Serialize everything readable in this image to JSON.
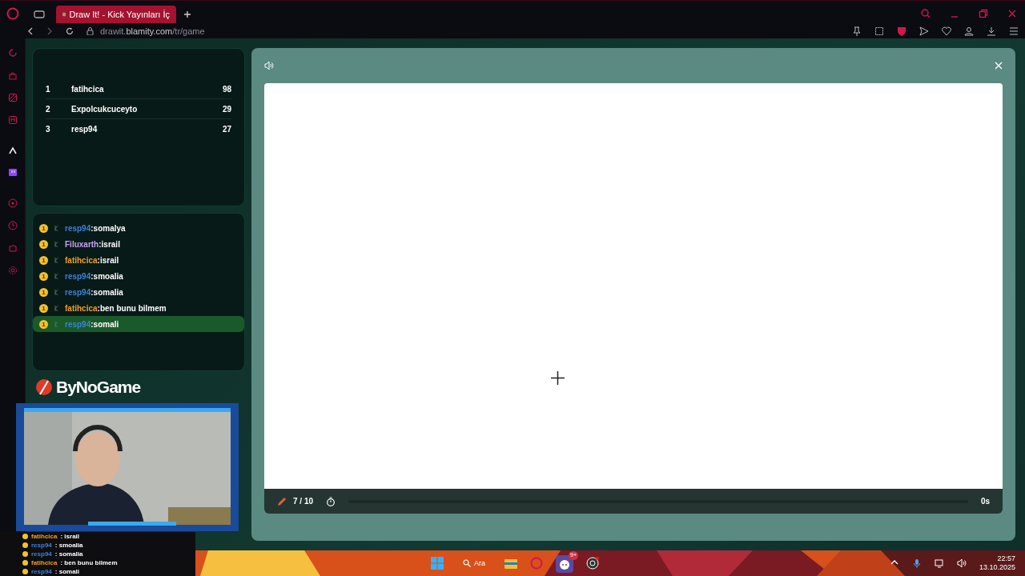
{
  "browser": {
    "tab_title": "Draw It! - Kick Yayınları İç",
    "url_host": "drawit.blamity.com",
    "url_path": "/tr/game"
  },
  "leaderboard": [
    {
      "rank": "1",
      "name": "fatihcica",
      "score": "98"
    },
    {
      "rank": "2",
      "name": "Expolcukcuceyto",
      "score": "29"
    },
    {
      "rank": "3",
      "name": "resp94",
      "score": "27"
    }
  ],
  "chat": [
    {
      "badge": "1",
      "user": "resp94",
      "color": "#3b82d6",
      "text": ":somalya",
      "selected": false
    },
    {
      "badge": "1",
      "user": "Filuxarth",
      "color": "#c9a0f0",
      "text": ":israil",
      "selected": false
    },
    {
      "badge": "1",
      "user": "fatihcica",
      "color": "#f0a020",
      "text": ":israil",
      "selected": false
    },
    {
      "badge": "1",
      "user": "resp94",
      "color": "#3b82d6",
      "text": ":smoalia",
      "selected": false
    },
    {
      "badge": "1",
      "user": "resp94",
      "color": "#3b82d6",
      "text": ":somalia",
      "selected": false
    },
    {
      "badge": "1",
      "user": "fatihcica",
      "color": "#f0a020",
      "text": ":ben bunu bilmem",
      "selected": false
    },
    {
      "badge": "1",
      "user": "resp94",
      "color": "#3b82d6",
      "text": ":somali",
      "selected": true
    }
  ],
  "sponsor": "ByNoGame",
  "stream_overlay_chat": [
    {
      "user": "fatihcica",
      "color": "#f0a020",
      "text": ": israil"
    },
    {
      "user": "resp94",
      "color": "#3b82d6",
      "text": ": smoalia"
    },
    {
      "user": "resp94",
      "color": "#3b82d6",
      "text": ": somalia"
    },
    {
      "user": "fatihcica",
      "color": "#f0a020",
      "text": ": ben bunu bilmem"
    },
    {
      "user": "resp94",
      "color": "#3b82d6",
      "text": ": somali"
    }
  ],
  "game": {
    "round": "7 / 10",
    "time_left": "0s"
  },
  "taskbar": {
    "search_label": "Ara",
    "discord_badge": "9+",
    "time": "22:57",
    "date": "13.10.2025"
  }
}
